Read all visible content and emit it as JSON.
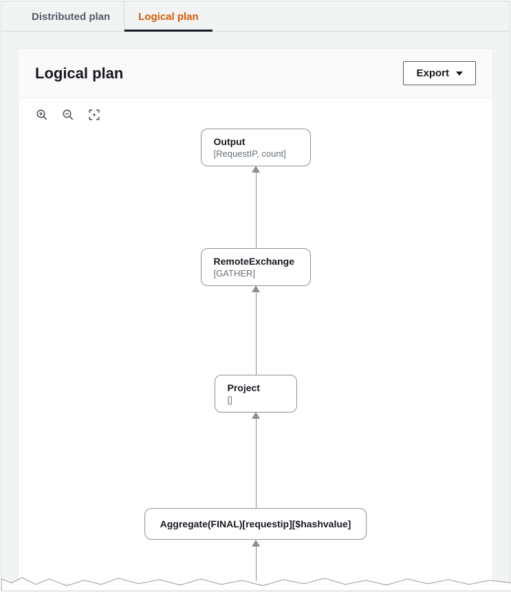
{
  "tabs": {
    "distributed": "Distributed plan",
    "logical": "Logical plan"
  },
  "panel": {
    "title": "Logical plan",
    "export": "Export"
  },
  "nodes": {
    "output": {
      "title": "Output",
      "sub": "[RequestIP, count]"
    },
    "remote": {
      "title": "RemoteExchange",
      "sub": "[GATHER]"
    },
    "project": {
      "title": "Project",
      "sub": "[]"
    },
    "aggregate": {
      "title": "Aggregate(FINAL)[requestip][$hashvalue]"
    }
  }
}
